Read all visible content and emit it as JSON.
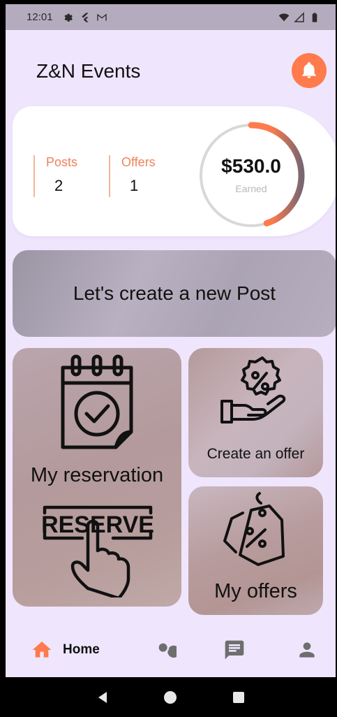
{
  "status_bar": {
    "time": "12:01",
    "left_icons": [
      "gear-icon",
      "flutter-icon",
      "gmail-icon"
    ],
    "right_icons": [
      "wifi-icon",
      "signal-icon",
      "battery-icon"
    ]
  },
  "header": {
    "title": "Z&N Events",
    "notification_icon": "bell-icon",
    "accent_color": "#ff7a4d"
  },
  "stats": {
    "posts_label": "Posts",
    "posts_value": "2",
    "offers_label": "Offers",
    "offers_value": "1",
    "earned_amount": "$530.0",
    "earned_label": "Earned",
    "earned_progress": 0.45
  },
  "create_post": {
    "label": "Let's create a new Post"
  },
  "tiles": {
    "reservation": {
      "label": "My reservation",
      "icons": [
        "calendar-check-icon",
        "reserve-button-icon"
      ],
      "reserve_text": "RESERVE"
    },
    "create_offer": {
      "label": "Create an offer",
      "icon": "percent-hand-icon"
    },
    "my_offers": {
      "label": "My offers",
      "icon": "percent-tag-icon"
    }
  },
  "bottom_nav": {
    "home_label": "Home",
    "items": [
      "home-icon",
      "search-icon",
      "chat-icon",
      "profile-icon"
    ]
  },
  "system_nav": [
    "back-icon",
    "home-circle-icon",
    "recents-icon"
  ]
}
